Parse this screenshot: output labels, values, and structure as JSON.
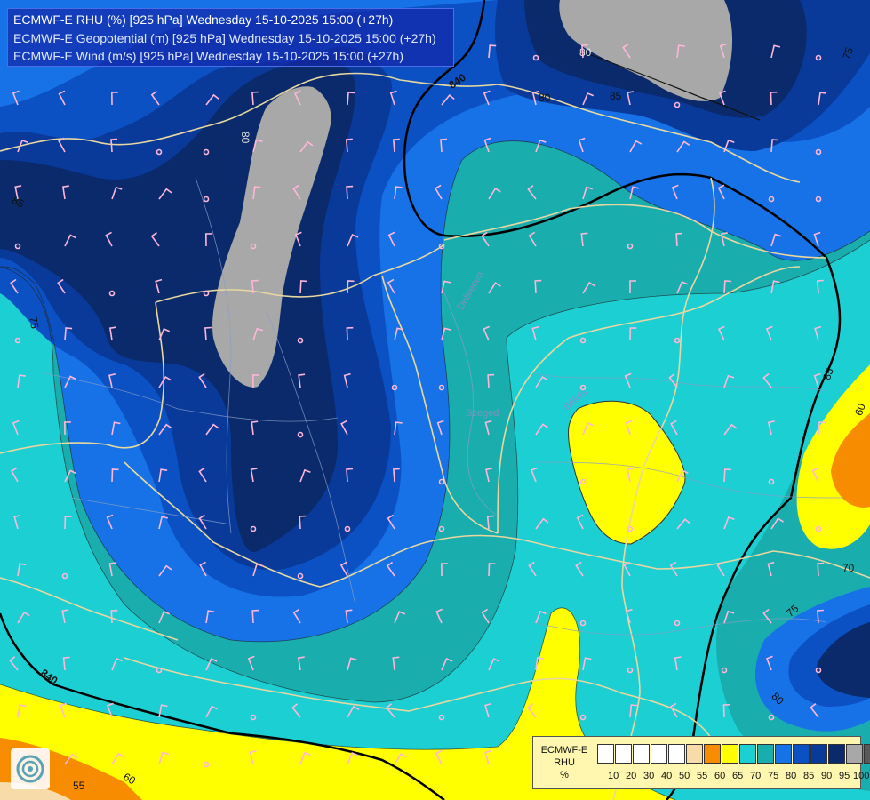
{
  "titles": {
    "line1": "ECMWF-E RHU (%) [925 hPa] Wednesday 15-10-2025 15:00 (+27h)",
    "line2": "ECMWF-E Geopotential (m) [925 hPa] Wednesday 15-10-2025 15:00 (+27h)",
    "line3": "ECMWF-E Wind (m/s) [925 hPa] Wednesday 15-10-2025 15:00 (+27h)"
  },
  "contour_labels": {
    "geo_840_top": "840",
    "geo_840_bottom": "840",
    "geo_85_right": "85",
    "rh_80_top": "80",
    "rh_80b": "80",
    "rh_85_top": "85",
    "rh_75_topright": "75",
    "rh_80_left": "80",
    "rh_85_left": "85",
    "rh_75_left": "75",
    "rh_60_right": "60",
    "rh_70_right": "70",
    "rh_75_br": "75",
    "rh_80_br": "80",
    "rh_55_bl": "55",
    "rh_60_bl": "60"
  },
  "place_labels": {
    "debrecen": "Debrecen",
    "bekes": "Békés",
    "szeged_area": "Szeged"
  },
  "legend": {
    "label_line1": "ECMWF-E",
    "label_line2": "RHU",
    "label_line3": "%",
    "colors": [
      "#ffffff",
      "#ffffff",
      "#ffffff",
      "#ffffff",
      "#ffffff",
      "#f7dcaa",
      "#f88c00",
      "#ffff00",
      "#1ccfd2",
      "#1aadae",
      "#1672e6",
      "#0b51c4",
      "#093a9a",
      "#0a2a6b",
      "#a8a8a8",
      "#595959"
    ],
    "ticks": [
      "10",
      "20",
      "30",
      "40",
      "50",
      "55",
      "60",
      "65",
      "70",
      "75",
      "80",
      "85",
      "90",
      "95",
      "100"
    ]
  },
  "colors": {
    "rh_55_60": "#f88c00",
    "rh_60_65": "#ffff00",
    "rh_65_70": "#1ccfd2",
    "rh_70_75": "#1aadae",
    "rh_75_80": "#1672e6",
    "rh_80_85": "#0b51c4",
    "rh_85_90": "#093a9a",
    "rh_90_95": "#0a2a6b",
    "rh_95_100": "#a8a8a8",
    "wind_barb": "#ffb6d9",
    "border": "#e8d7a0"
  }
}
